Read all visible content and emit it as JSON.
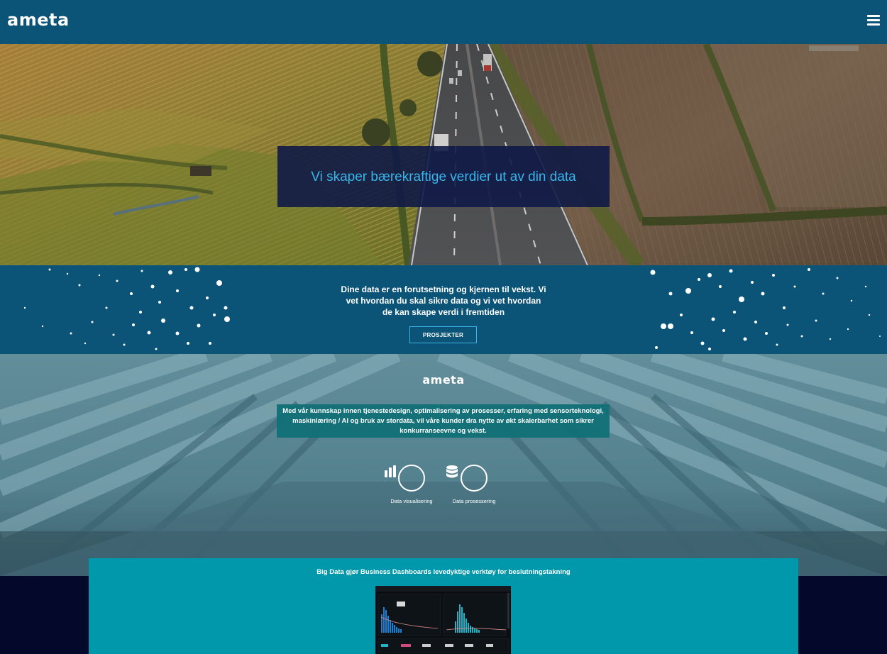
{
  "header": {
    "logo": "ameta",
    "menu_icon": "hamburger-menu-icon"
  },
  "hero": {
    "title": "Vi skaper bærekraftige verdier ut av din data"
  },
  "intro": {
    "text": "Dine data er en forutsetning og kjernen til vekst. Vi vet hvordan du skal sikre data og vi vet hvordan de kan skape verdi i fremtiden",
    "button_label": "PROSJEKTER"
  },
  "about": {
    "logo": "ameta",
    "text": "Med vår kunnskap innen tjenestedesign, optimalisering av prosesser, erfaring med sensorteknologi, maskinlæring / AI og bruk av stordata, vil våre kunder dra nytte av økt skalerbarhet som sikrer konkurranseevne og vekst.",
    "features": [
      {
        "label": "Data visualisering",
        "icon": "bar-chart-icon"
      },
      {
        "label": "Data prosessering",
        "icon": "database-icon"
      }
    ]
  },
  "dashboards": {
    "title": "Big Data gjør Business Dashboards levedyktige verktøy for beslutningstakning"
  }
}
